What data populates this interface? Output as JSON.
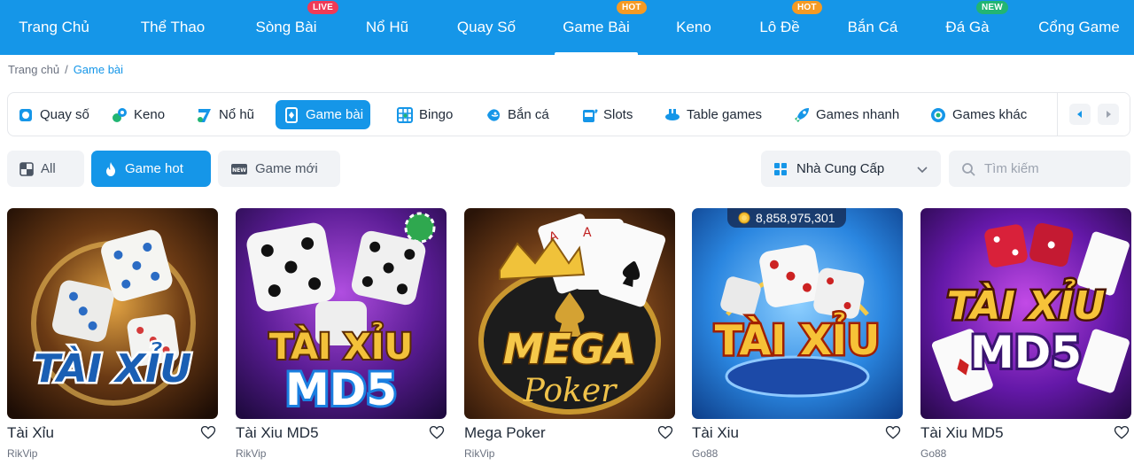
{
  "nav": {
    "items": [
      {
        "label": "Trang Chủ",
        "badge": ""
      },
      {
        "label": "Thể Thao",
        "badge": ""
      },
      {
        "label": "Sòng Bài",
        "badge": "LIVE"
      },
      {
        "label": "Nổ Hũ",
        "badge": ""
      },
      {
        "label": "Quay Số",
        "badge": ""
      },
      {
        "label": "Game Bài",
        "badge": "HOT",
        "active": true
      },
      {
        "label": "Keno",
        "badge": ""
      },
      {
        "label": "Lô Đề",
        "badge": "HOT"
      },
      {
        "label": "Bắn Cá",
        "badge": ""
      },
      {
        "label": "Đá Gà",
        "badge": "NEW"
      },
      {
        "label": "Cổng Game",
        "badge": ""
      }
    ]
  },
  "breadcrumb": {
    "home": "Trang chủ",
    "separator": "/",
    "current": "Game bài"
  },
  "categories": {
    "items": [
      {
        "label": "Quay số",
        "icon": "lottery-icon"
      },
      {
        "label": "Keno",
        "icon": "keno-icon"
      },
      {
        "label": "Nổ hũ",
        "icon": "slot-seven-icon"
      },
      {
        "label": "Game bài",
        "icon": "card-game-icon",
        "active": true
      },
      {
        "label": "Bingo",
        "icon": "bingo-icon"
      },
      {
        "label": "Bắn cá",
        "icon": "fish-icon"
      },
      {
        "label": "Slots",
        "icon": "slot-machine-icon"
      },
      {
        "label": "Table games",
        "icon": "table-game-icon"
      },
      {
        "label": "Games nhanh",
        "icon": "rocket-icon"
      },
      {
        "label": "Games khác",
        "icon": "chip-icon"
      }
    ]
  },
  "filters": {
    "all": "All",
    "hot": "Game hot",
    "new": "Game mới",
    "provider_label": "Nhà Cung Cấp",
    "search_placeholder": "Tìm kiếm"
  },
  "games": [
    {
      "title": "Tài Xỉu",
      "provider": "RikVip",
      "art_text": "TÀI XỈU",
      "jackpot": ""
    },
    {
      "title": "Tài Xiu MD5",
      "provider": "RikVip",
      "art_text": "TÀI XỈU",
      "art_sub": "MD5",
      "jackpot": ""
    },
    {
      "title": "Mega Poker",
      "provider": "RikVip",
      "art_text": "MEGA",
      "art_sub": "Poker",
      "jackpot": ""
    },
    {
      "title": "Tài Xiu",
      "provider": "Go88",
      "art_text": "TÀI XỈU",
      "jackpot": "8,858,975,301"
    },
    {
      "title": "Tài Xiu MD5",
      "provider": "Go88",
      "art_text": "TÀI XỈU",
      "art_sub": "MD5",
      "jackpot": ""
    }
  ],
  "colors": {
    "primary": "#1596e8",
    "live": "#ef3a56",
    "hot": "#f59a23",
    "new": "#22b573"
  }
}
